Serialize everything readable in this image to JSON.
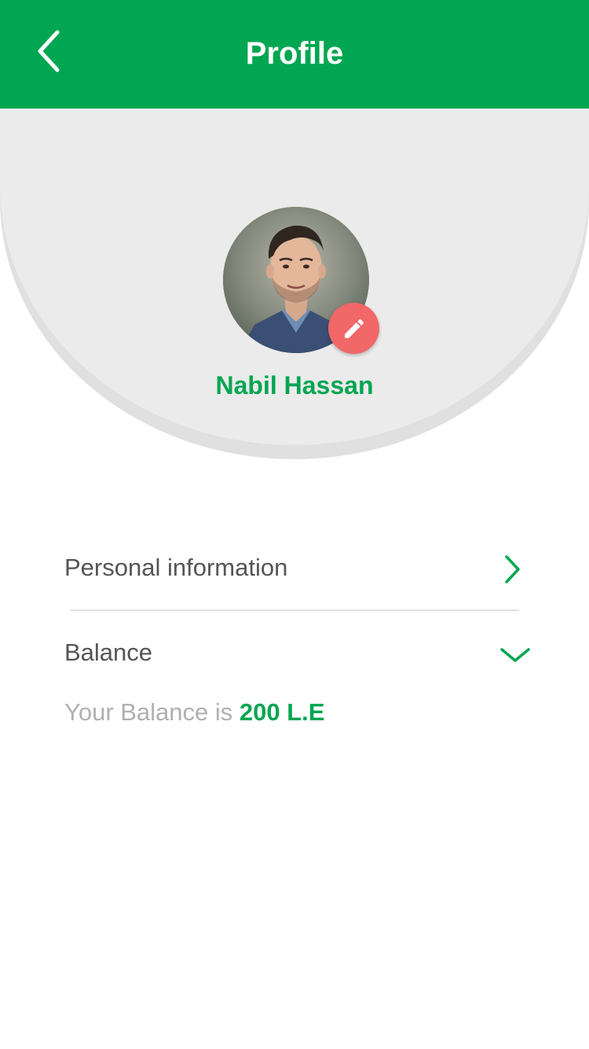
{
  "header": {
    "title": "Profile",
    "back_icon": "chevron-left-icon",
    "background_color": "#00a651"
  },
  "profile": {
    "name": "Nabil Hassan",
    "edit_icon": "pencil-icon",
    "edit_button_color": "#f26767",
    "hero_background_color": "#ebebeb"
  },
  "menu": {
    "items": [
      {
        "label": "Personal information",
        "icon": "chevron-right-icon"
      },
      {
        "label": "Balance",
        "icon": "chevron-down-icon"
      }
    ]
  },
  "balance": {
    "prefix": "Your Balance is ",
    "amount": "200 L.E"
  },
  "colors": {
    "accent": "#00a651",
    "text_primary": "#555555",
    "text_muted": "#b0b0b0"
  }
}
